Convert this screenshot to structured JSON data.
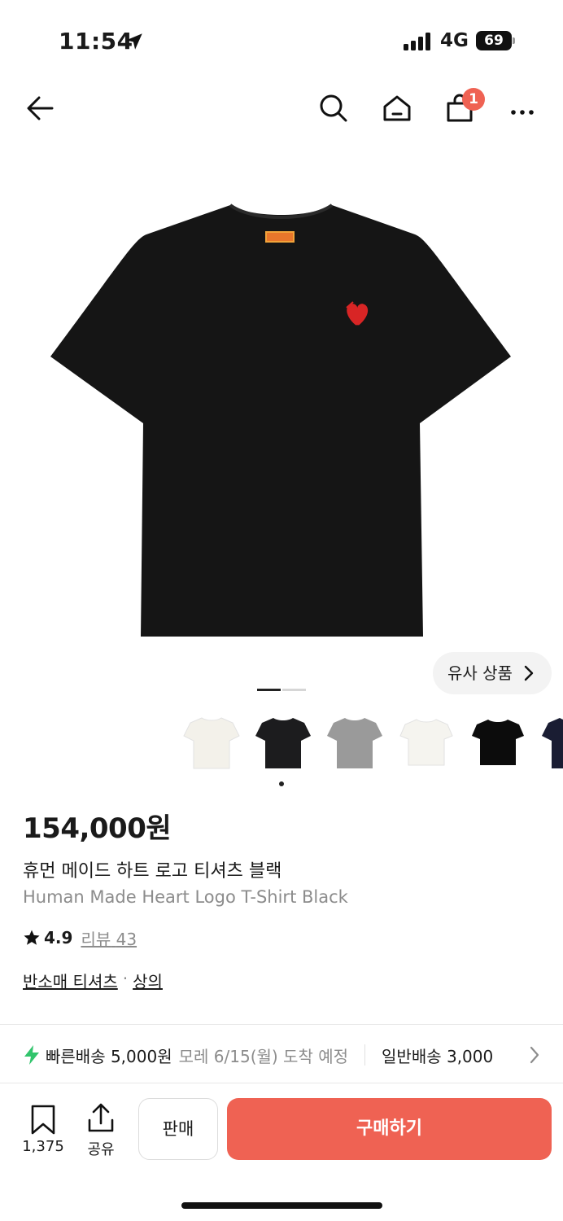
{
  "status_bar": {
    "time": "11:54",
    "network": "4G",
    "battery": "69"
  },
  "nav": {
    "cart_count": "1"
  },
  "hero": {
    "similar_label": "유사 상품"
  },
  "product": {
    "price": "154,000원",
    "name_ko": "휴먼 메이드 하트 로고 티셔츠 블랙",
    "name_en": "Human Made Heart Logo T-Shirt Black",
    "rating": "4.9",
    "review_label": "리뷰",
    "review_count": "43",
    "categories": [
      "반소매 티셔츠",
      "상의"
    ]
  },
  "thumbnails": [
    {
      "color": "#f3f1ea"
    },
    {
      "color": "#1c1c1e"
    },
    {
      "color": "#9a9a9a"
    },
    {
      "color": "#f5f4ef"
    },
    {
      "color": "#0c0c0c"
    },
    {
      "color": "#1a1d33"
    }
  ],
  "shipping": {
    "fast_label": "빠른배송 5,000원",
    "fast_eta": "모레 6/15(월) 도착 예정",
    "normal_label": "일반배송 3,000"
  },
  "bottom_bar": {
    "bookmark_count": "1,375",
    "share_label": "공유",
    "sell_label": "판매",
    "buy_label": "구매하기"
  },
  "colors": {
    "accent": "#ef6253",
    "fast_ship": "#31c46c",
    "text": "#1a1a1a",
    "muted": "#8c8c8c"
  }
}
